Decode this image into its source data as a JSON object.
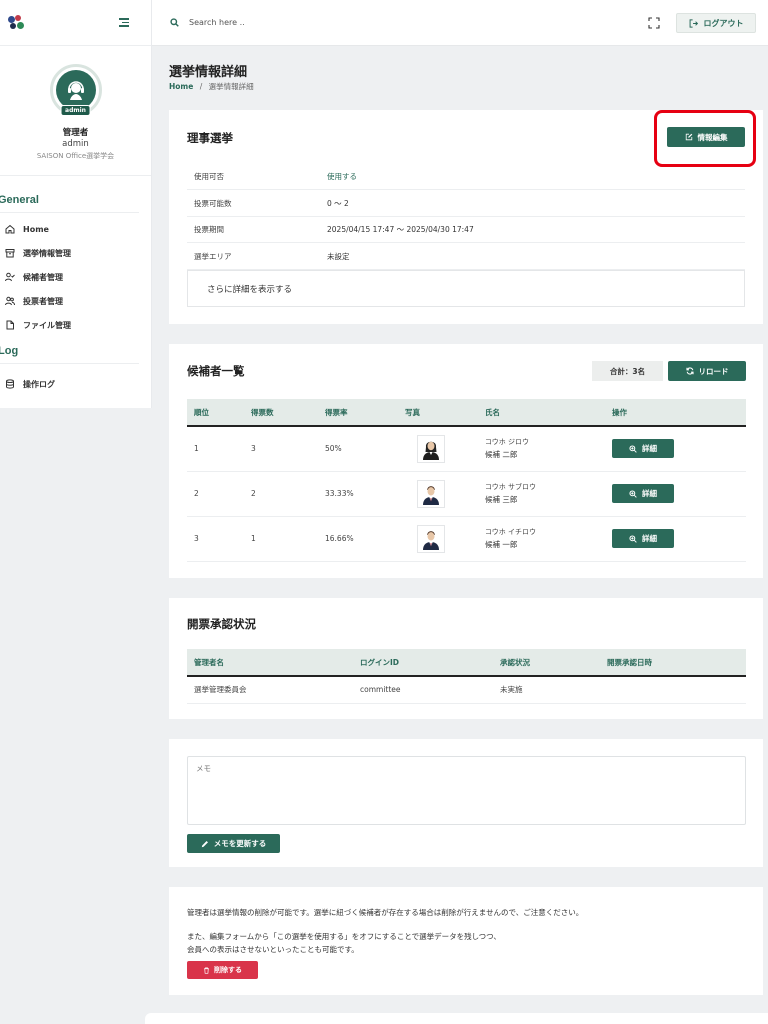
{
  "sidebar": {
    "profile": {
      "role": "管理者",
      "username": "admin",
      "badge": "admin",
      "organization": "SAISON Office選挙学会"
    },
    "sections": {
      "general": "General",
      "log": "Log"
    },
    "items": [
      {
        "label": "Home",
        "icon": "home-icon"
      },
      {
        "label": "選挙情報管理",
        "icon": "archive-icon"
      },
      {
        "label": "候補者管理",
        "icon": "user-check-icon"
      },
      {
        "label": "投票者管理",
        "icon": "users-icon"
      },
      {
        "label": "ファイル管理",
        "icon": "file-icon"
      },
      {
        "label": "操作ログ",
        "icon": "database-icon"
      }
    ]
  },
  "topbar": {
    "search_placeholder": "Search here ..",
    "logout_label": "ログアウト"
  },
  "page": {
    "title": "選挙情報詳細",
    "breadcrumb_home": "Home",
    "breadcrumb_sep": "/",
    "breadcrumb_current": "選挙情報詳細"
  },
  "election": {
    "title": "理事選挙",
    "edit_label": "情報編集",
    "rows": [
      {
        "label": "使用可否",
        "value": "使用する"
      },
      {
        "label": "投票可能数",
        "value": "0 〜 2"
      },
      {
        "label": "投票期間",
        "value": "2025/04/15 17:47 〜 2025/04/30 17:47"
      },
      {
        "label": "選挙エリア",
        "value": "未設定"
      }
    ],
    "more_label": "さらに詳細を表示する"
  },
  "candidates": {
    "title": "候補者一覧",
    "total_label": "合計：3名",
    "reload_label": "リロード",
    "headers": [
      "順位",
      "得票数",
      "得票率",
      "写真",
      "氏名",
      "操作"
    ],
    "rows": [
      {
        "rank": "1",
        "votes": "3",
        "rate": "50%",
        "kana": "コウホ ジロウ",
        "name": "候補 二郎",
        "photo": "female",
        "action": "詳細"
      },
      {
        "rank": "2",
        "votes": "2",
        "rate": "33.33%",
        "kana": "コウホ サブロウ",
        "name": "候補 三郎",
        "photo": "male",
        "action": "詳細"
      },
      {
        "rank": "3",
        "votes": "1",
        "rate": "16.66%",
        "kana": "コウホ イチロウ",
        "name": "候補 一郎",
        "photo": "male",
        "action": "詳細"
      }
    ]
  },
  "approval": {
    "title": "開票承認状況",
    "headers": [
      "管理者名",
      "ログインID",
      "承認状況",
      "開票承認日時"
    ],
    "rows": [
      {
        "admin": "選挙管理委員会",
        "login_id": "committee",
        "status": "未実施",
        "date": ""
      }
    ]
  },
  "memo": {
    "placeholder": "メモ",
    "update_label": "メモを更新する"
  },
  "delete_section": {
    "note1": "管理者は選挙情報の削除が可能です。選挙に紐づく候補者が存在する場合は削除が行えませんので、ご注意ください。",
    "note2": "また、編集フォームから「この選挙を使用する」をオフにすることで選挙データを残しつつ、",
    "note3": "会員への表示はさせないといったことも可能です。",
    "delete_label": "削除する"
  },
  "colors": {
    "accent": "#2b6a5a",
    "danger": "#d9344a",
    "highlight": "#e60012",
    "pending": "#c07a3c"
  }
}
